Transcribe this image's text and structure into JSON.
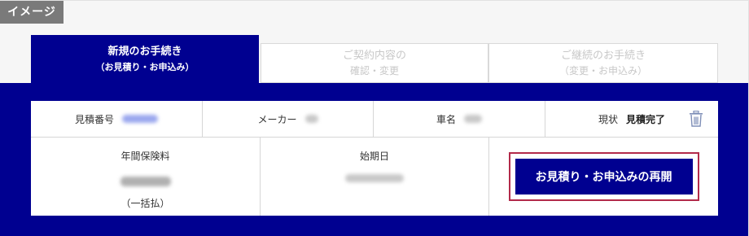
{
  "image_tag": "イメージ",
  "tabs": [
    {
      "line1": "新規のお手続き",
      "line2": "（お見積り・お申込み）",
      "active": true
    },
    {
      "line1": "ご契約内容の",
      "line2": "確認・変更",
      "active": false
    },
    {
      "line1": "ご継続のお手続き",
      "line2": "（変更・お申込み）",
      "active": false
    }
  ],
  "quote": {
    "number_label": "見積番号",
    "maker_label": "メーカー",
    "car_name_label": "車名",
    "status_label": "現状",
    "status_value": "見積完了",
    "annual_premium_label": "年間保険料",
    "payment_note": "（一括払）",
    "start_date_label": "始期日"
  },
  "actions": {
    "resume_label": "お見積り・お申込みの再開"
  },
  "icons": {
    "delete": "trash-icon"
  },
  "colors": {
    "brand_navy": "#000090",
    "highlight_frame": "#b22a4a",
    "tag_gray": "#7a7a7a"
  }
}
